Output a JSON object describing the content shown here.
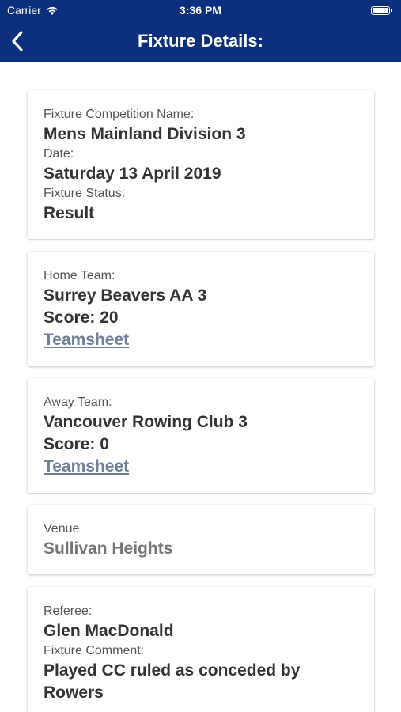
{
  "status_bar": {
    "carrier": "Carrier",
    "time": "3:36 PM"
  },
  "nav": {
    "title": "Fixture Details:"
  },
  "fixture": {
    "competition_label": "Fixture Competition Name:",
    "competition_value": "Mens Mainland Division 3",
    "date_label": "Date:",
    "date_value": "Saturday 13 April 2019",
    "status_label": "Fixture Status:",
    "status_value": "Result"
  },
  "home": {
    "label": "Home Team:",
    "team": "Surrey Beavers AA 3",
    "score": "Score: 20",
    "teamsheet": "Teamsheet"
  },
  "away": {
    "label": "Away Team:",
    "team": "Vancouver Rowing Club 3",
    "score": "Score: 0",
    "teamsheet": "Teamsheet"
  },
  "venue": {
    "label": "Venue",
    "value": "Sullivan Heights"
  },
  "officials": {
    "referee_label": "Referee:",
    "referee_value": "Glen MacDonald",
    "comment_label": "Fixture Comment:",
    "comment_value": "Played CC ruled as conceded by Rowers"
  },
  "colors": {
    "header_bg": "#0b2f7d",
    "link": "#6f7f97"
  }
}
